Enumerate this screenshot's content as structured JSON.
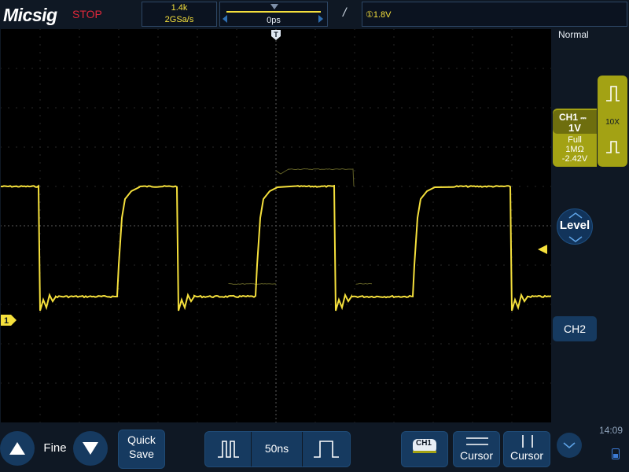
{
  "header": {
    "brand": "Micsig",
    "run_state": "STOP",
    "memory_depth": "1.4k",
    "sample_rate": "2GSa/s",
    "horizontal_position": "0ps",
    "trigger_edge_icon": "rising-edge-icon",
    "trigger_level": "①1.8V"
  },
  "right_panel": {
    "trigger_mode": "Normal",
    "ch1": {
      "name": "CH1",
      "coupling_symbol": "⎓",
      "scale": "1V",
      "bandwidth": "Full",
      "impedance": "1MΩ",
      "offset": "-2.42V",
      "probe": "10X"
    },
    "level_button": "Level",
    "ch2_button": "CH2",
    "clock": "14:09"
  },
  "screen": {
    "ch1_marker": "1",
    "trigger_marker_label": "T"
  },
  "bottom_bar": {
    "fine_label": "Fine",
    "quick_save_line1": "Quick",
    "quick_save_line2": "Save",
    "timebase": "50ns",
    "ch1_select": "CH1",
    "cursor1_label": "Cursor",
    "cursor2_label": "Cursor"
  },
  "colors": {
    "ch1_trace": "#f5e03c",
    "ch1_badge": "#a3a214",
    "button_bg": "#163a60",
    "stop_red": "#e0283a"
  }
}
